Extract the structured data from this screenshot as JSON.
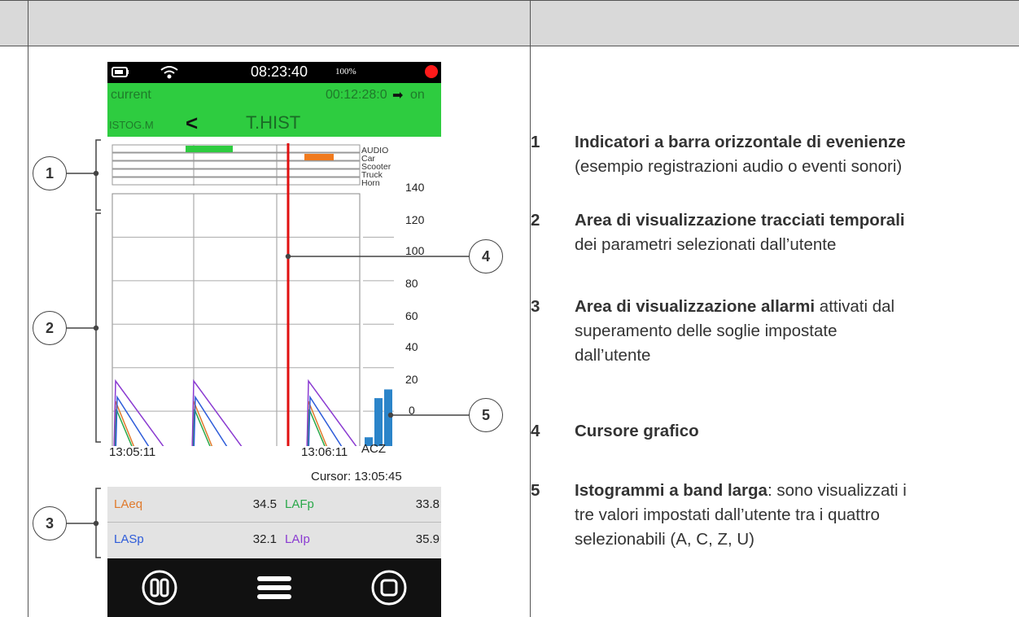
{
  "device": {
    "status": {
      "time": "08:23:40",
      "battery_pct": "100%"
    },
    "header": {
      "mode": "current",
      "elapsed": "00:12:28:0",
      "arrow": "➡",
      "state": "on",
      "left_tab": "ISTOG.M",
      "back": "<",
      "title": "T.HIST"
    },
    "events": [
      "AUDIO",
      "Car",
      "Scooter",
      "Truck",
      "Horn"
    ],
    "y_ticks": [
      "140",
      "120",
      "100",
      "80",
      "60",
      "40",
      "20",
      "0"
    ],
    "time_start": "13:05:11",
    "time_mid": "13:06:11",
    "bands_label": "ACZ",
    "cursor_text": "Cursor: 13:05:45",
    "readings": [
      {
        "label": "LAeq",
        "value": "34.5",
        "color": "#e07a2c"
      },
      {
        "label": "LAFp",
        "value": "33.8",
        "color": "#2aa84a"
      },
      {
        "label": "LASp",
        "value": "32.1",
        "color": "#2e5cd9"
      },
      {
        "label": "LAIp",
        "value": "35.9",
        "color": "#8a3ad1"
      }
    ],
    "colors": {
      "green_bar": "#2ecc40",
      "cursor": "#e01010",
      "bars": "#2b84c9",
      "record": "#ff1a1a"
    }
  },
  "chart_data": {
    "type": "bar",
    "categories": [
      "A",
      "C",
      "Z"
    ],
    "values": [
      28,
      46,
      50
    ],
    "ylim": [
      0,
      140
    ]
  },
  "callouts": [
    "1",
    "2",
    "3",
    "4",
    "5"
  ],
  "legend": [
    {
      "num": "1",
      "bold": "Indicatori a barra orizzontale di evenienze",
      "rest": "",
      "line2": "(esempio registrazioni audio o eventi sonori)",
      "line3": ""
    },
    {
      "num": "2",
      "bold": "Area di visualizzazione tracciati temporali",
      "rest": "",
      "line2": "dei parametri selezionati dall’utente",
      "line3": ""
    },
    {
      "num": "3",
      "bold": "Area di visualizzazione allarmi",
      "rest": " attivati dal",
      "line2": "superamento delle soglie impostate",
      "line3": "dall’utente"
    },
    {
      "num": "4",
      "bold": "Cursore grafico",
      "rest": "",
      "line2": "",
      "line3": ""
    },
    {
      "num": "5",
      "bold": "Istogrammi a band larga",
      "rest": ": sono visualizzati i",
      "line2": "tre valori impostati dall’utente tra i quattro",
      "line3": "selezionabili (A, C, Z, U)"
    }
  ]
}
